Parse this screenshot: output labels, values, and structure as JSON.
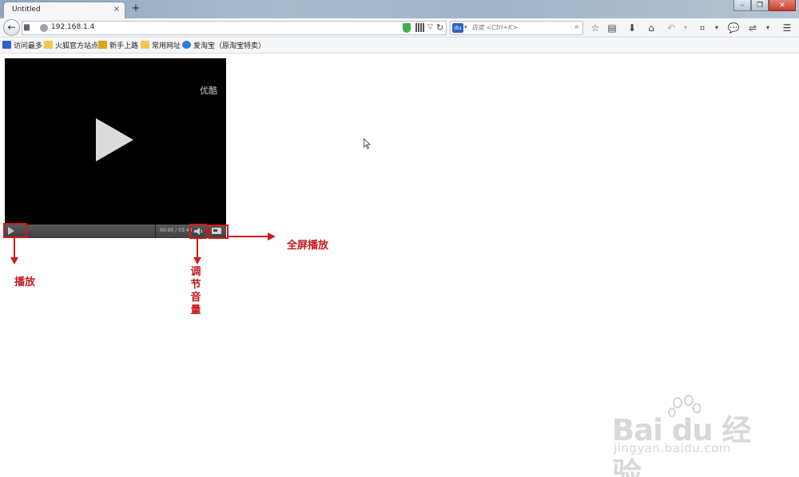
{
  "browser": {
    "tab_title": "Untitled",
    "tab_close": "×",
    "new_tab": "+",
    "url": "192.168.1.4",
    "search_placeholder": "百度 <Ctrl+K>",
    "search_engine_icon": "baidu-paw-icon"
  },
  "bookmarks": [
    {
      "label": "访问最多",
      "icon_color": "#2e63c8"
    },
    {
      "label": "火狐官方站点",
      "icon_color": "#f3c94c"
    },
    {
      "label": "新手上路",
      "icon_color": "#e0a51a"
    },
    {
      "label": "常用网址",
      "icon_color": "#f3c94c"
    },
    {
      "label": "爱淘宝（原淘宝特卖）",
      "icon_color": "#2b7fd6"
    }
  ],
  "player": {
    "brand_watermark": "优酷",
    "time": "00:00 / 03:40"
  },
  "annotations": {
    "play": "播放",
    "volume": [
      "调",
      "节",
      "音",
      "量"
    ],
    "fullscreen": "全屏播放",
    "color": "#d0191b"
  },
  "watermark": {
    "logo": "Bai du 经验",
    "url": "jingyan.baidu.com"
  }
}
